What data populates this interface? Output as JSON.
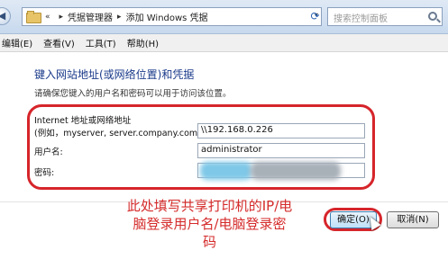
{
  "address_bar": {
    "overflow": "«",
    "breadcrumbs": [
      "凭据管理器",
      "添加 Windows 凭据"
    ],
    "search_placeholder": "搜索控制面板"
  },
  "menu": [
    "编辑(E)",
    "查看(V)",
    "工具(T)",
    "帮助(H)"
  ],
  "main": {
    "heading": "键入网站地址(或网络位置)和凭据",
    "description": "请确保您键入的用户名和密码可以用于访问该位置。",
    "address_label_line1": "Internet 地址或网络地址",
    "address_label_line2": "(例如，myserver, server.company.com):",
    "address_value": "\\\\192.168.0.226",
    "username_label": "用户名:",
    "username_value": "administrator",
    "password_label": "密码:"
  },
  "annotation": {
    "line1": "此处填写共享打印机的IP/电",
    "line2": "脑登录用户名/电脑登录密",
    "line3": "码"
  },
  "buttons": {
    "ok": "确定(O)",
    "cancel": "取消(N)"
  },
  "colors": {
    "highlight_ring": "#d6252b",
    "annotation_text": "#d52b2b",
    "heading_text": "#1a3a8a"
  }
}
